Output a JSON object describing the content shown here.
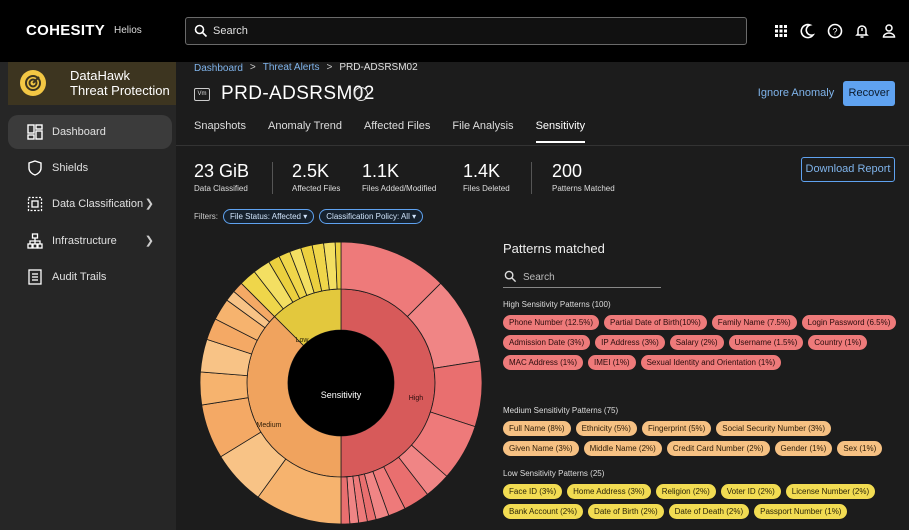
{
  "topbar": {
    "brand": "COHESITY",
    "brand_sub": "Helios",
    "search_placeholder": "Search"
  },
  "sidebar": {
    "app_title_1": "DataHawk",
    "app_title_2": "Threat Protection",
    "items": [
      {
        "label": "Dashboard",
        "icon": "dashboard-icon"
      },
      {
        "label": "Shields",
        "icon": "shield-icon"
      },
      {
        "label": "Data Classification",
        "icon": "data-classification-icon"
      },
      {
        "label": "Infrastructure",
        "icon": "infrastructure-icon"
      },
      {
        "label": "Audit Trails",
        "icon": "audit-icon"
      }
    ]
  },
  "header": {
    "breadcrumb": [
      "Dashboard",
      "Threat Alerts",
      "PRD-ADSRSM02"
    ],
    "vm_badge": "Vm",
    "title": "PRD-ADSRSM02",
    "ignore_label": "Ignore Anomaly",
    "recover_label": "Recover"
  },
  "tabs": [
    "Snapshots",
    "Anomaly Trend",
    "Affected Files",
    "File Analysis",
    "Sensitivity"
  ],
  "stats": [
    {
      "value": "23 GiB",
      "label": "Data Classified"
    },
    {
      "value": "2.5K",
      "label": "Affected Files"
    },
    {
      "value": "1.1K",
      "label": "Files Added/Modified"
    },
    {
      "value": "1.4K",
      "label": "Files Deleted"
    },
    {
      "value": "200",
      "label": "Patterns Matched"
    }
  ],
  "download_label": "Download Report",
  "filters": {
    "label": "Filters:",
    "chips": [
      "File Status: Affected",
      "Classification Policy: All"
    ]
  },
  "sunburst": {
    "center": "Sensitivity",
    "labels": {
      "high": "High",
      "medium": "Medium",
      "low": "Low"
    }
  },
  "patterns": {
    "title": "Patterns matched",
    "search_placeholder": "Search",
    "groups": [
      {
        "label": "High Sensitivity Patterns (100)",
        "level": "high",
        "items": [
          "Phone Number (12.5%)",
          "Partial Date of Birth(10%)",
          "Family Name (7.5%)",
          "Login Password (6.5%)",
          "Admission Date (3%)",
          "IP Address (3%)",
          "Salary (2%)",
          "Username (1.5%)",
          "Country (1%)",
          "MAC Address (1%)",
          "IMEI (1%)",
          "Sexual Identity and Orientation (1%)"
        ]
      },
      {
        "label": "Medium Sensitivity Patterns (75)",
        "level": "med",
        "items": [
          "Full Name (8%)",
          "Ethnicity (5%)",
          "Fingerprint (5%)",
          "Social Security Number (3%)",
          "Given Name (3%)",
          "Middle Name (2%)",
          "Credit Card Number (2%)",
          "Gender (1%)",
          "Sex (1%)"
        ]
      },
      {
        "label": "Low Sensitivity Patterns (25)",
        "level": "low",
        "items": [
          "Face ID (3%)",
          "Home Address (3%)",
          "Religion (2%)",
          "Voter ID (2%)",
          "License Number (2%)",
          "Bank Account (2%)",
          "Date of Birth (2%)",
          "Date of Death (2%)",
          "Passport Number (1%)"
        ]
      }
    ]
  },
  "colors": {
    "high": "#ee7a7a",
    "medium": "#f6b36e",
    "low": "#efd64a",
    "accent": "#5fa2f0"
  }
}
